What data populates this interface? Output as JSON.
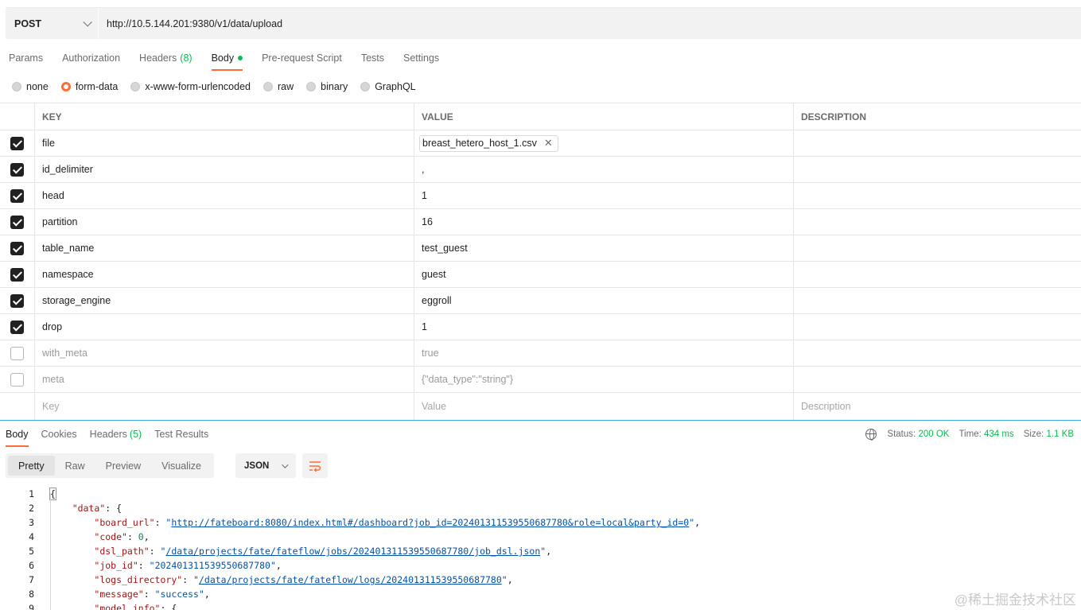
{
  "request": {
    "method": "POST",
    "url": "http://10.5.144.201:9380/v1/data/upload"
  },
  "request_tabs": [
    {
      "label": "Params"
    },
    {
      "label": "Authorization"
    },
    {
      "label": "Headers",
      "count": "(8)"
    },
    {
      "label": "Body"
    },
    {
      "label": "Pre-request Script"
    },
    {
      "label": "Tests"
    },
    {
      "label": "Settings"
    }
  ],
  "body_types": [
    {
      "label": "none",
      "selected": false
    },
    {
      "label": "form-data",
      "selected": true
    },
    {
      "label": "x-www-form-urlencoded",
      "selected": false
    },
    {
      "label": "raw",
      "selected": false
    },
    {
      "label": "binary",
      "selected": false
    },
    {
      "label": "GraphQL",
      "selected": false
    }
  ],
  "params_table": {
    "headers": {
      "key": "KEY",
      "value": "VALUE",
      "description": "DESCRIPTION"
    },
    "rows": [
      {
        "key": "file",
        "value": "breast_hetero_host_1.csv",
        "checked": true
      },
      {
        "key": "id_delimiter",
        "value": ",",
        "checked": true
      },
      {
        "key": "head",
        "value": "1",
        "checked": true
      },
      {
        "key": "partition",
        "value": "16",
        "checked": true
      },
      {
        "key": "table_name",
        "value": "test_guest",
        "checked": true
      },
      {
        "key": "namespace",
        "value": "guest",
        "checked": true
      },
      {
        "key": "storage_engine",
        "value": "eggroll",
        "checked": true
      },
      {
        "key": "drop",
        "value": "1",
        "checked": true
      },
      {
        "key": "with_meta",
        "value": "true",
        "checked": false
      },
      {
        "key": "meta",
        "value": "{\"data_type\":\"string\"}",
        "checked": false
      }
    ],
    "placeholders": {
      "key": "Key",
      "value": "Value",
      "description": "Description"
    }
  },
  "response_tabs": [
    {
      "label": "Body"
    },
    {
      "label": "Cookies"
    },
    {
      "label": "Headers",
      "count": "(5)"
    },
    {
      "label": "Test Results"
    }
  ],
  "response_status": {
    "status_label": "Status:",
    "status_value": "200 OK",
    "time_label": "Time:",
    "time_value": "434 ms",
    "size_label": "Size:",
    "size_value": "1.1 KB",
    "colors": {
      "ok": "#0cbb52",
      "accent": "#ff6c37"
    }
  },
  "view_modes": [
    "Pretty",
    "Raw",
    "Preview",
    "Visualize"
  ],
  "format": "JSON",
  "code_lines": {
    "n1": "1",
    "n2": "2",
    "n3": "3",
    "n4": "4",
    "n5": "5",
    "n6": "6",
    "n7": "7",
    "n8": "8",
    "n9": "9",
    "l1_open": "{",
    "l2_key": "\"data\"",
    "l2_rest": ": {",
    "l3_key": "\"board_url\"",
    "l3_val": "\"http://fateboard:8080/index.html#/dashboard?job_id=202401311539550687780&role=local&party_id=0\"",
    "l4_key": "\"code\"",
    "l4_val": "0",
    "l5_key": "\"dsl_path\"",
    "l5_val": "\"/data/projects/fate/fateflow/jobs/202401311539550687780/job_dsl.json\"",
    "l6_key": "\"job_id\"",
    "l6_val": "\"202401311539550687780\"",
    "l7_key": "\"logs_directory\"",
    "l7_val": "\"/data/projects/fate/fateflow/logs/202401311539550687780\"",
    "l8_key": "\"message\"",
    "l8_val": "\"success\"",
    "l9_key": "\"model_info\"",
    "l9_rest": ": {"
  },
  "watermark": "@稀土掘金技术社区"
}
